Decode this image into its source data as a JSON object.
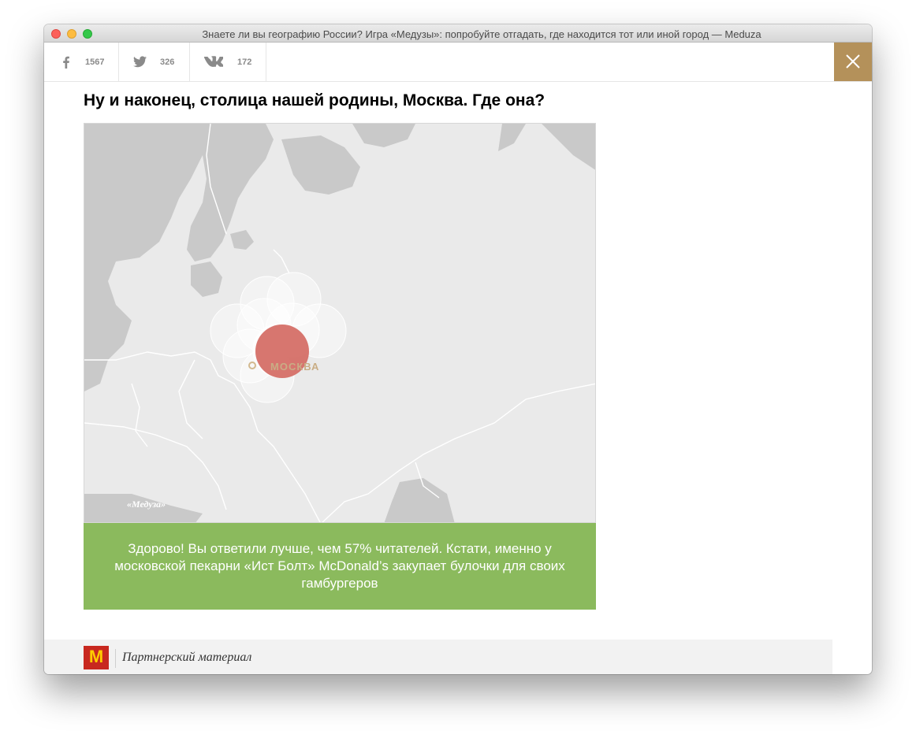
{
  "window": {
    "title": "Знаете ли вы географию России? Игра «Медузы»: попробуйте отгадать, где находится тот или иной город — Meduza"
  },
  "share": {
    "facebook": {
      "icon": "facebook-icon",
      "count": "1567"
    },
    "twitter": {
      "icon": "twitter-icon",
      "count": "326"
    },
    "vk": {
      "icon": "vk-icon",
      "count": "172"
    }
  },
  "close": {
    "icon": "close-icon",
    "color": "#b4915a"
  },
  "question": {
    "text": "Ну и наконец, столица нашей родины, Москва. Где она?"
  },
  "map": {
    "city_label": "МОСКВА",
    "watermark": "«Медуза»",
    "guess_color": "#d46a63",
    "reader_guess_count": 9
  },
  "result": {
    "text": "Здорово! Вы ответили лучше, чем 57% читателей. Кстати, именно у московской пекарни «Ист Болт» McDonald’s закупает булочки для своих гамбургеров",
    "color": "#8bba5d"
  },
  "partner": {
    "logo": "mcdonalds-logo",
    "logo_letter": "M",
    "label": "Партнерский материал"
  }
}
